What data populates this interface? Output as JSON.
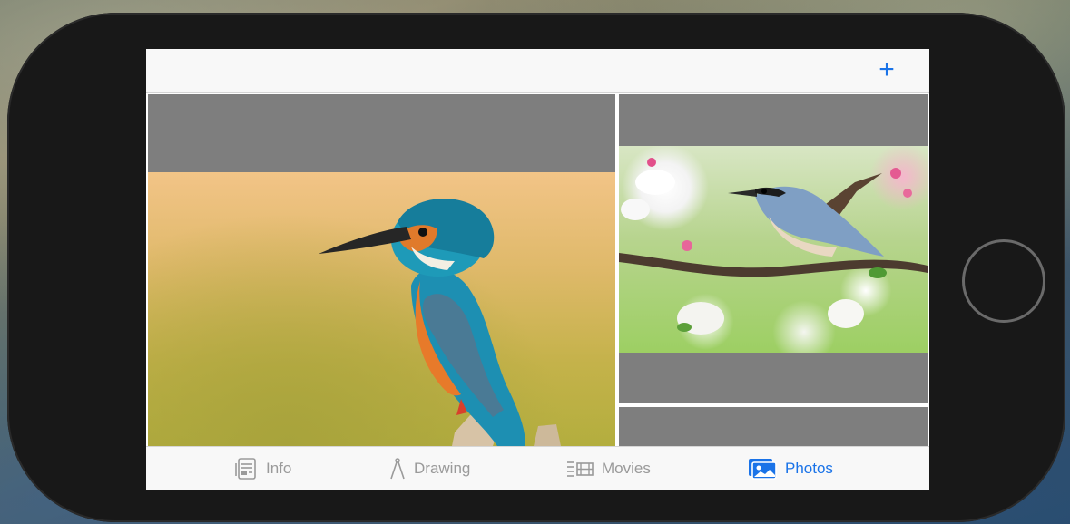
{
  "navbar": {
    "add_icon": "plus-icon",
    "add_label": "+"
  },
  "grid": {
    "items": [
      {
        "name": "kingfisher-photo"
      },
      {
        "name": "nuthatch-photo"
      },
      {
        "name": "empty-photo-cell"
      }
    ]
  },
  "tabs": [
    {
      "label": "Info",
      "icon": "info-icon",
      "selected": false
    },
    {
      "label": "Drawing",
      "icon": "drawing-icon",
      "selected": false
    },
    {
      "label": "Movies",
      "icon": "movies-icon",
      "selected": false
    },
    {
      "label": "Photos",
      "icon": "photos-icon",
      "selected": true
    }
  ],
  "colors": {
    "accent": "#1a73e8",
    "inactive": "#9a9a9a",
    "placeholder": "#7e7e7e"
  }
}
